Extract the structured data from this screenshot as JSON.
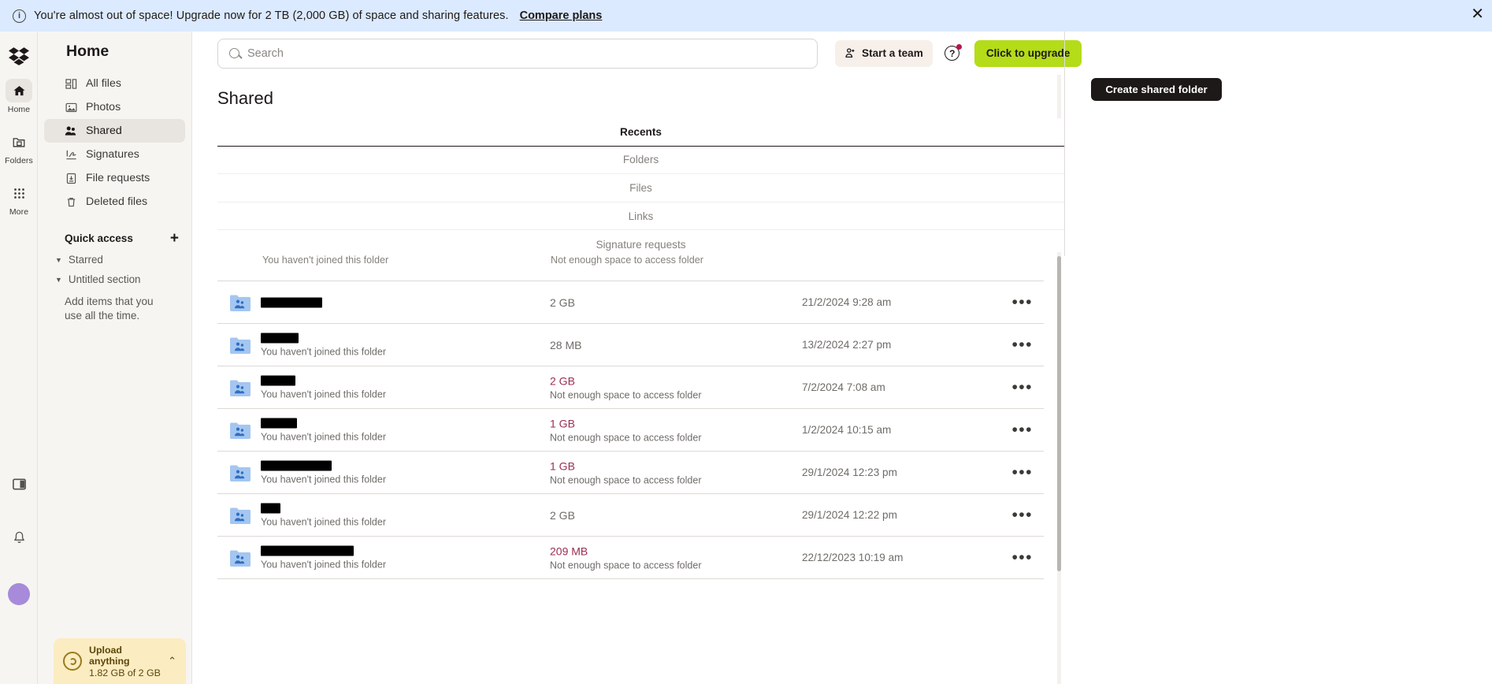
{
  "banner": {
    "icon": "info-icon",
    "text": "You're almost out of space! Upgrade now for 2 TB (2,000 GB) of space and sharing features.",
    "link_label": "Compare plans",
    "close_label": "✕",
    "background": "#dbeafe"
  },
  "rail": {
    "logo": "dropbox-logo",
    "items": [
      {
        "label": "Home",
        "icon": "home-icon",
        "active": true
      },
      {
        "label": "Folders",
        "icon": "folder-icon",
        "active": false
      },
      {
        "label": "More",
        "icon": "grid-dots-icon",
        "active": false
      }
    ],
    "bottom": [
      {
        "name": "sidebar-toggle-icon"
      },
      {
        "name": "bell-icon"
      },
      {
        "name": "avatar"
      }
    ]
  },
  "sidebar": {
    "title": "Home",
    "nav": [
      {
        "label": "All files",
        "icon": "all-files-icon",
        "active": false
      },
      {
        "label": "Photos",
        "icon": "photos-icon",
        "active": false
      },
      {
        "label": "Shared",
        "icon": "shared-icon",
        "active": true
      },
      {
        "label": "Signatures",
        "icon": "signature-icon",
        "active": false
      },
      {
        "label": "File requests",
        "icon": "file-request-icon",
        "active": false
      },
      {
        "label": "Deleted files",
        "icon": "trash-icon",
        "active": false
      }
    ],
    "quick_access": {
      "label": "Quick access",
      "add_label": "+",
      "sections": [
        {
          "label": "Starred"
        },
        {
          "label": "Untitled section"
        }
      ],
      "empty_text": "Add items that you use all the time."
    },
    "upload_widget": {
      "title": "Upload anything",
      "subtitle": "1.82 GB of 2 GB",
      "chevron": "⌃",
      "background": "#fbecc2"
    }
  },
  "header": {
    "search": {
      "placeholder": "Search",
      "value": "",
      "icon": "search-icon"
    },
    "start_team_label": "Start a team",
    "start_team_icon": "add-person-icon",
    "help_icon": "question-mark-icon",
    "help_has_notification": true,
    "upgrade_label": "Click to upgrade",
    "upgrade_color": "#b4dc19"
  },
  "actions": {
    "create_shared_folder_label": "Create shared folder"
  },
  "main": {
    "page_title": "Shared",
    "tabs": [
      {
        "label": "Recents",
        "active": true
      },
      {
        "label": "Folders",
        "active": false
      },
      {
        "label": "Files",
        "active": false
      },
      {
        "label": "Links",
        "active": false
      },
      {
        "label": "Signature requests",
        "active": false
      }
    ],
    "partial_row": {
      "name_text": "You haven't joined this folder",
      "note_text": "Not enough space to access folder"
    },
    "rows": [
      {
        "name_redacted": true,
        "name_bar_width": 78,
        "sub": "",
        "size": "2 GB",
        "size_warn": false,
        "note": "",
        "date": "21/2/2024 9:28 am",
        "menu": "•••",
        "icon": "shared-folder-icon"
      },
      {
        "name_redacted": true,
        "name_bar_width": 48,
        "sub": "You haven't joined this folder",
        "size": "28 MB",
        "size_warn": false,
        "note": "",
        "date": "13/2/2024 2:27 pm",
        "menu": "•••",
        "icon": "shared-folder-icon"
      },
      {
        "name_redacted": true,
        "name_bar_width": 44,
        "sub": "You haven't joined this folder",
        "size": "2 GB",
        "size_warn": true,
        "note": "Not enough space to access folder",
        "date": "7/2/2024 7:08 am",
        "menu": "•••",
        "icon": "shared-folder-icon"
      },
      {
        "name_redacted": true,
        "name_bar_width": 46,
        "sub": "You haven't joined this folder",
        "size": "1 GB",
        "size_warn": true,
        "note": "Not enough space to access folder",
        "date": "1/2/2024 10:15 am",
        "menu": "•••",
        "icon": "shared-folder-icon"
      },
      {
        "name_redacted": true,
        "name_bar_width": 90,
        "sub": "You haven't joined this folder",
        "size": "1 GB",
        "size_warn": true,
        "note": "Not enough space to access folder",
        "date": "29/1/2024 12:23 pm",
        "menu": "•••",
        "icon": "shared-folder-icon"
      },
      {
        "name_redacted": true,
        "name_bar_width": 25,
        "sub": "You haven't joined this folder",
        "size": "2 GB",
        "size_warn": false,
        "note": "",
        "date": "29/1/2024 12:22 pm",
        "menu": "•••",
        "icon": "shared-folder-icon"
      },
      {
        "name_redacted": true,
        "name_bar_width": 118,
        "sub": "You haven't joined this folder",
        "size": "209 MB",
        "size_warn": true,
        "note": "Not enough space to access folder",
        "date": "22/12/2023 10:19 am",
        "menu": "•••",
        "icon": "shared-folder-icon"
      }
    ]
  }
}
